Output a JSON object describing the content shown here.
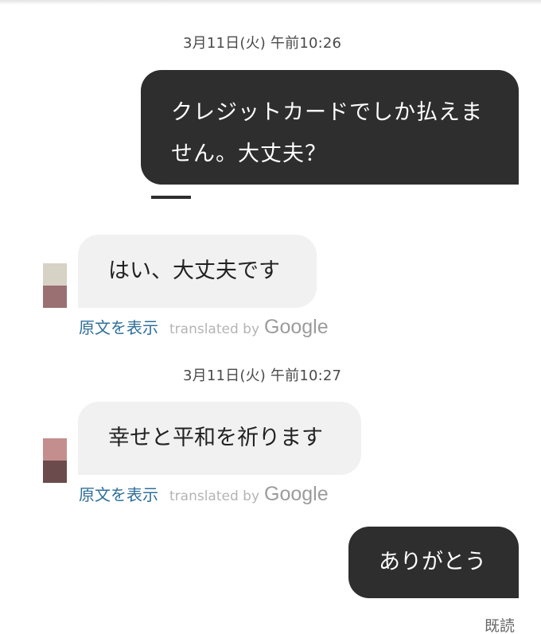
{
  "messages": [
    {
      "type": "timestamp",
      "text": "3月11日(火) 午前10:26"
    },
    {
      "type": "outgoing",
      "text": "クレジットカードでしか払えません。大丈夫？"
    },
    {
      "type": "incoming",
      "text": "はい、大丈夫です",
      "show_original": "原文を表示",
      "translated_by": "translated by",
      "google": "Google"
    },
    {
      "type": "timestamp",
      "text": "3月11日(火) 午前10:27"
    },
    {
      "type": "incoming",
      "text": "幸せと平和を祈ります",
      "show_original": "原文を表示",
      "translated_by": "translated by",
      "google": "Google"
    },
    {
      "type": "outgoing",
      "text": "ありがとう"
    }
  ],
  "read_receipt": "既読",
  "colors": {
    "outgoing_bubble": "#2e2e2e",
    "incoming_bubble": "#f1f1f1",
    "link": "#2f6f9a",
    "avatar1": [
      "#d6d2c6",
      "#9b7072"
    ],
    "avatar2": [
      "#c48e8e",
      "#6b4b4b"
    ]
  }
}
